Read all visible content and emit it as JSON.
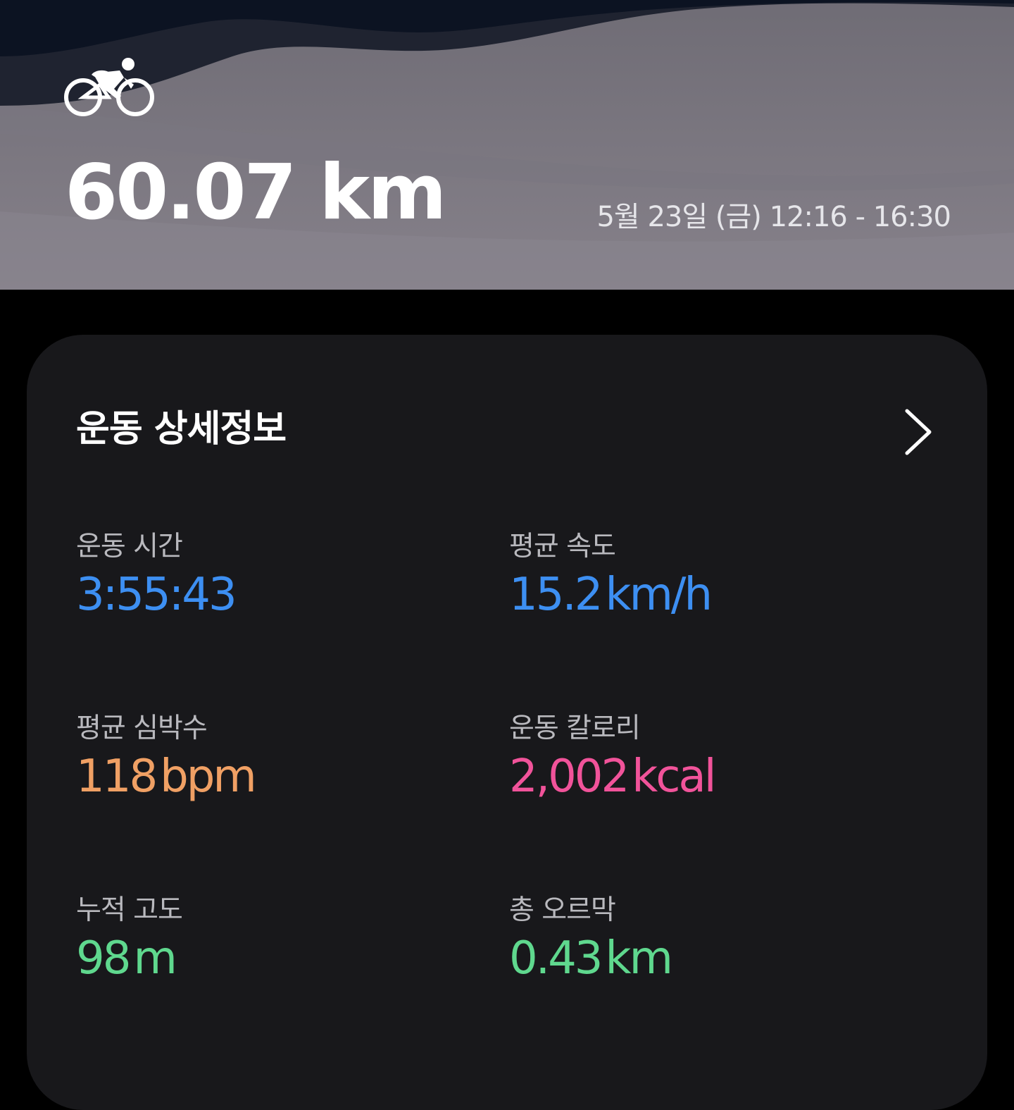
{
  "hero": {
    "activity_icon": "cycling-icon",
    "distance": "60.07 km",
    "datetime": "5월 23일 (금) 12:16 - 16:30"
  },
  "card": {
    "title": "운동 상세정보",
    "chevron_icon": "chevron-right-icon",
    "stats": [
      {
        "label": "운동 시간",
        "value": "3:55:43",
        "unit": "",
        "color": "#3d8ff2"
      },
      {
        "label": "평균 속도",
        "value": "15.2",
        "unit": "km/h",
        "color": "#3d8ff2"
      },
      {
        "label": "평균 심박수",
        "value": "118",
        "unit": "bpm",
        "color": "#f0a064"
      },
      {
        "label": "운동 칼로리",
        "value": "2,002",
        "unit": "kcal",
        "color": "#f1539a"
      },
      {
        "label": "누적 고도",
        "value": "98",
        "unit": "m",
        "color": "#5fd88e"
      },
      {
        "label": "총 오르막",
        "value": "0.43",
        "unit": "km",
        "color": "#5fd88e"
      }
    ]
  }
}
